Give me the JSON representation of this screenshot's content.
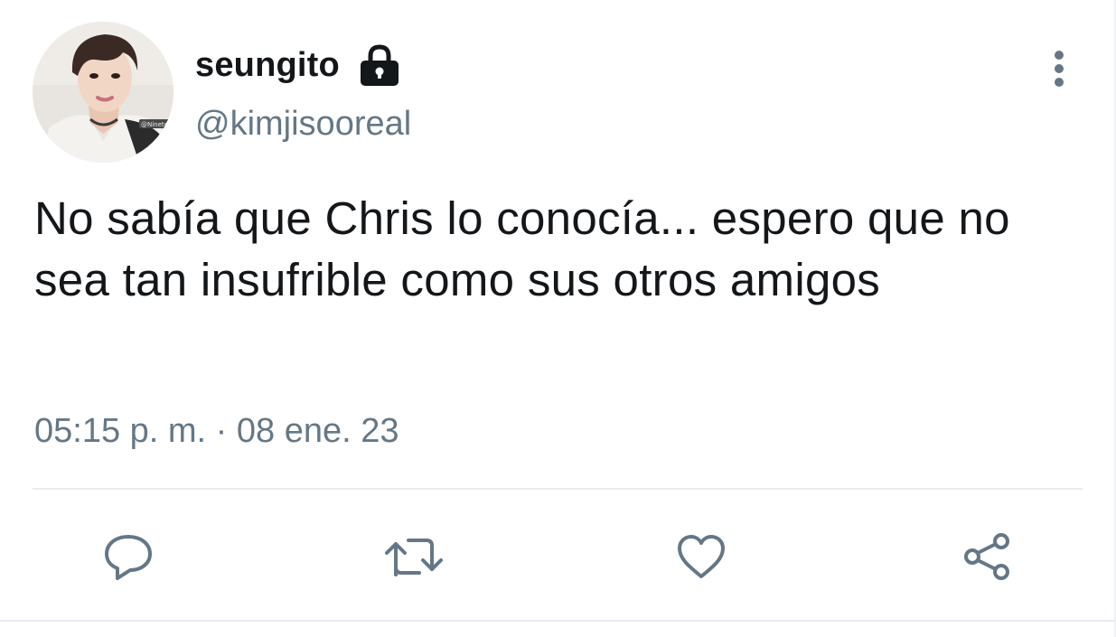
{
  "tweet": {
    "author": {
      "display_name": "seungito",
      "handle": "@kimjisooreal",
      "protected_icon": "lock-icon",
      "avatar_text": "@Ninetoes"
    },
    "text": "No sabía que Chris lo conocía... espero que no sea tan insufrible como sus otros amigos",
    "timestamp": "05:15 p. m. · 08 ene. 23",
    "more_icon": "more-vertical-icon"
  },
  "actions": [
    {
      "name": "reply",
      "icon": "reply-icon"
    },
    {
      "name": "retweet",
      "icon": "retweet-icon"
    },
    {
      "name": "like",
      "icon": "heart-icon"
    },
    {
      "name": "share",
      "icon": "share-icon"
    }
  ],
  "colors": {
    "text_primary": "#14171a",
    "text_secondary": "#657786",
    "divider": "#e6ecf0"
  }
}
